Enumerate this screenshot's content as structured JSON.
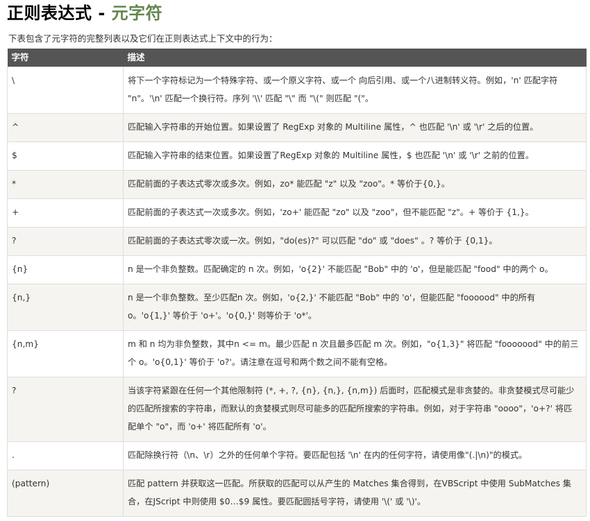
{
  "title_main": "正则表达式 - ",
  "title_accent": "元字符",
  "intro": "下表包含了元字符的完整列表以及它们在正则表达式上下文中的行为：",
  "headers": [
    "字符",
    "描述"
  ],
  "rows": [
    {
      "char": "\\",
      "desc": "将下一个字符标记为一个特殊字符、或一个原义字符、或一个 向后引用、或一个八进制转义符。例如，'n' 匹配字符 \"n\"。'\\n' 匹配一个换行符。序列 '\\\\' 匹配 \"\\\" 而 \"\\(\" 则匹配 \"(\"。"
    },
    {
      "char": "^",
      "desc": "匹配输入字符串的开始位置。如果设置了 RegExp 对象的 Multiline 属性，^ 也匹配 '\\n' 或 '\\r' 之后的位置。"
    },
    {
      "char": "$",
      "desc": "匹配输入字符串的结束位置。如果设置了RegExp 对象的 Multiline 属性，$ 也匹配 '\\n' 或 '\\r' 之前的位置。"
    },
    {
      "char": "*",
      "desc": "匹配前面的子表达式零次或多次。例如，zo* 能匹配 \"z\" 以及 \"zoo\"。* 等价于{0,}。"
    },
    {
      "char": "+",
      "desc": "匹配前面的子表达式一次或多次。例如，'zo+' 能匹配 \"zo\" 以及 \"zoo\"，但不能匹配 \"z\"。+ 等价于 {1,}。"
    },
    {
      "char": "?",
      "desc": "匹配前面的子表达式零次或一次。例如，\"do(es)?\" 可以匹配 \"do\" 或 \"does\" 。? 等价于 {0,1}。"
    },
    {
      "char": "{n}",
      "desc": "n 是一个非负整数。匹配确定的 n 次。例如，'o{2}' 不能匹配 \"Bob\" 中的 'o'，但是能匹配 \"food\" 中的两个 o。"
    },
    {
      "char": "{n,}",
      "desc": "n 是一个非负整数。至少匹配n 次。例如，'o{2,}' 不能匹配 \"Bob\" 中的 'o'，但能匹配 \"foooood\" 中的所有 o。'o{1,}' 等价于 'o+'。'o{0,}' 则等价于 'o*'。"
    },
    {
      "char": "{n,m}",
      "desc": "m 和 n 均为非负整数，其中n <= m。最少匹配 n 次且最多匹配 m 次。例如，\"o{1,3}\" 将匹配 \"fooooood\" 中的前三个 o。'o{0,1}' 等价于 'o?'。请注意在逗号和两个数之间不能有空格。"
    },
    {
      "char": "?",
      "desc": "当该字符紧跟在任何一个其他限制符 (*, +, ?, {n}, {n,}, {n,m}) 后面时，匹配模式是非贪婪的。非贪婪模式尽可能少的匹配所搜索的字符串，而默认的贪婪模式则尽可能多的匹配所搜索的字符串。例如，对于字符串 \"oooo\"，'o+?' 将匹配单个 \"o\"，而 'o+' 将匹配所有 'o'。"
    },
    {
      "char": ".",
      "desc": "匹配除换行符（\\n、\\r）之外的任何单个字符。要匹配包括 '\\n' 在内的任何字符，请使用像\"(.|\\n)\"的模式。"
    },
    {
      "char": "(pattern)",
      "desc": "匹配 pattern 并获取这一匹配。所获取的匹配可以从产生的 Matches 集合得到，在VBScript 中使用 SubMatches 集合，在JScript 中则使用 $0…$9 属性。要匹配圆括号字符，请使用 '\\(' 或 '\\)'。"
    }
  ]
}
